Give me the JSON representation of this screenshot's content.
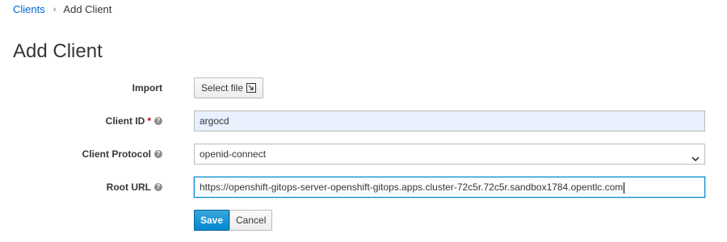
{
  "breadcrumb": {
    "parent": "Clients",
    "separator": "›",
    "current": "Add Client"
  },
  "page": {
    "title": "Add Client"
  },
  "form": {
    "import": {
      "label": "Import",
      "button_label": "Select file",
      "icon": "import-icon"
    },
    "client_id": {
      "label": "Client ID",
      "required_marker": "*",
      "value": "argocd",
      "help_icon": "help-icon"
    },
    "client_protocol": {
      "label": "Client Protocol",
      "selected": "openid-connect",
      "help_icon": "help-icon"
    },
    "root_url": {
      "label": "Root URL",
      "value": "https://openshift-gitops-server-openshift-gitops.apps.cluster-72c5r.72c5r.sandbox1784.opentlc.com",
      "help_icon": "help-icon"
    }
  },
  "actions": {
    "save_label": "Save",
    "cancel_label": "Cancel"
  },
  "colors": {
    "link": "#0066cc",
    "primary": "#0088ce",
    "required": "#cc0000",
    "autofill_bg": "#e8f0fe"
  }
}
